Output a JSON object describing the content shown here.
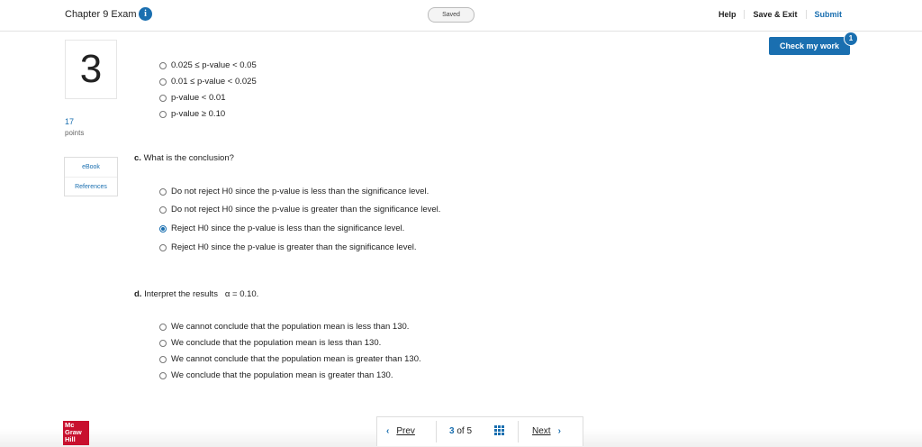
{
  "header": {
    "exam_title": "Chapter 9 Exam",
    "info_icon": "info-icon",
    "saved_status": "Saved",
    "help": "Help",
    "save_exit": "Save & Exit",
    "submit": "Submit"
  },
  "check_work": {
    "label": "Check my work",
    "badge": "1"
  },
  "question": {
    "number": "3",
    "points": "17",
    "points_label": "points"
  },
  "sidebar": {
    "ebook": "eBook",
    "references": "References"
  },
  "part_b_options": [
    "0.025 ≤ p-value < 0.05",
    "0.01 ≤ p-value < 0.025",
    "p-value < 0.01",
    "p-value ≥ 0.10"
  ],
  "part_c": {
    "prefix": "c.",
    "question": "What is the conclusion?",
    "options": [
      "Do not reject H0 since the p-value is less than the significance level.",
      "Do not reject H0 since the p-value is greater than the significance level.",
      "Reject H0 since the p-value is less than the significance level.",
      "Reject H0 since the p-value is greater than the significance level."
    ],
    "selected_index": 2
  },
  "part_d": {
    "prefix": "d.",
    "question": "Interpret the results",
    "alpha": "α = 0.10.",
    "options": [
      "We cannot conclude that the population mean is less than 130.",
      "We conclude that the population mean is less than 130.",
      "We cannot conclude that the population mean is greater than 130.",
      "We conclude that the population mean is greater than 130."
    ]
  },
  "footer": {
    "logo_lines": [
      "Mc",
      "Graw",
      "Hill"
    ],
    "prev": "Prev",
    "current_page": "3",
    "of_label": "of",
    "total_pages": "5",
    "next": "Next"
  }
}
